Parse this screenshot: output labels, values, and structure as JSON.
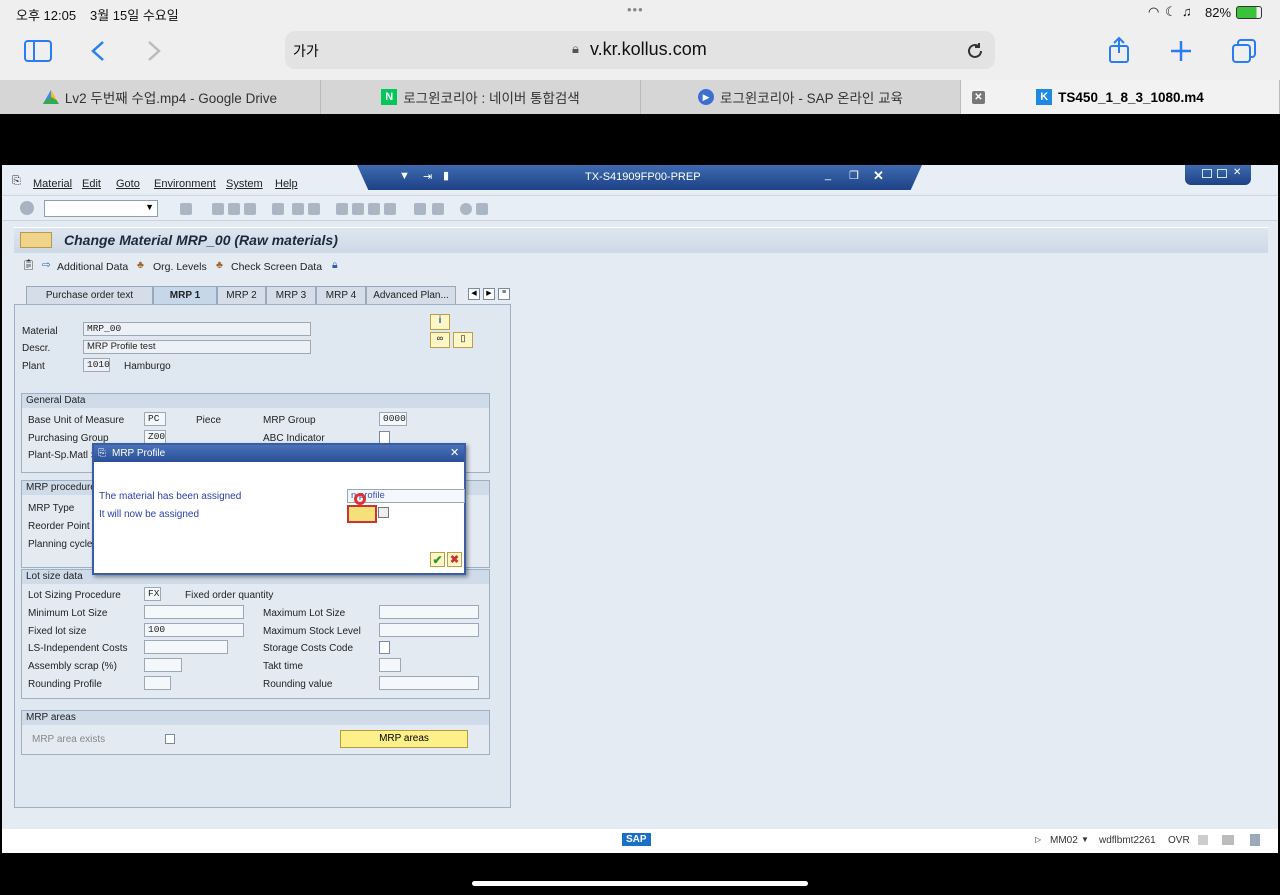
{
  "ios": {
    "time": "오후 12:05",
    "date": "3월 15일 수요일",
    "battery": "82%",
    "dots": "•••"
  },
  "safari": {
    "textsize": "가가",
    "url": "v.kr.kollus.com"
  },
  "tabs": [
    "Lv2 두번째 수업.mp4 - Google Drive",
    "로그윈코리아 : 네이버 통합검색",
    "로그윈코리아 - SAP 온라인 교육",
    "TS450_1_8_3_1080.m4"
  ],
  "sap": {
    "menu": [
      "Material",
      "Edit",
      "Goto",
      "Environment",
      "System",
      "Help"
    ],
    "window_title": "TX-S41909FP00-PREP",
    "screen_title": "Change Material MRP_00 (Raw materials)",
    "app_toolbar": [
      "Additional Data",
      "Org. Levels",
      "Check Screen Data"
    ],
    "tabstrip": [
      "Purchase order text",
      "MRP 1",
      "MRP 2",
      "MRP 3",
      "MRP 4",
      "Advanced Plan..."
    ],
    "header": {
      "material_label": "Material",
      "material": "MRP_00",
      "descr_label": "Descr.",
      "descr": "MRP Profile test",
      "plant_label": "Plant",
      "plant": "1010",
      "plant_name": "Hamburgo"
    },
    "general": {
      "title": "General Data",
      "buom_label": "Base Unit of Measure",
      "buom": "PC",
      "buom_text": "Piece",
      "mrpgroup_label": "MRP Group",
      "mrpgroup": "0000",
      "pgroup_label": "Purchasing Group",
      "pgroup": "Z00",
      "abc_label": "ABC Indicator",
      "plant_sp_label": "Plant-Sp.Matl S"
    },
    "mrpproc": {
      "title": "MRP procedure",
      "type_label": "MRP Type",
      "reorder_label": "Reorder Point",
      "cycle_label": "Planning cycle"
    },
    "lot": {
      "title": "Lot size data",
      "proc_label": "Lot Sizing Procedure",
      "proc": "FX",
      "proc_text": "Fixed order quantity",
      "min_label": "Minimum Lot Size",
      "max_label": "Maximum Lot Size",
      "fixed_label": "Fixed lot size",
      "fixed": "100",
      "maxstock_label": "Maximum Stock Level",
      "lsind_label": "LS-Independent Costs",
      "storage_label": "Storage Costs Code",
      "scrap_label": "Assembly scrap (%)",
      "takt_label": "Takt time",
      "round_label": "Rounding Profile",
      "roundval_label": "Rounding value"
    },
    "areas": {
      "title": "MRP areas",
      "exists_label": "MRP area exists",
      "button": "MRP areas"
    },
    "dialog": {
      "title": "MRP Profile",
      "line1": "The material has been assigned",
      "line2": "It will now be assigned",
      "field": "n profile"
    },
    "status": {
      "tcode": "MM02",
      "server": "wdflbmt2261",
      "mode": "OVR",
      "logo": "SAP"
    }
  }
}
